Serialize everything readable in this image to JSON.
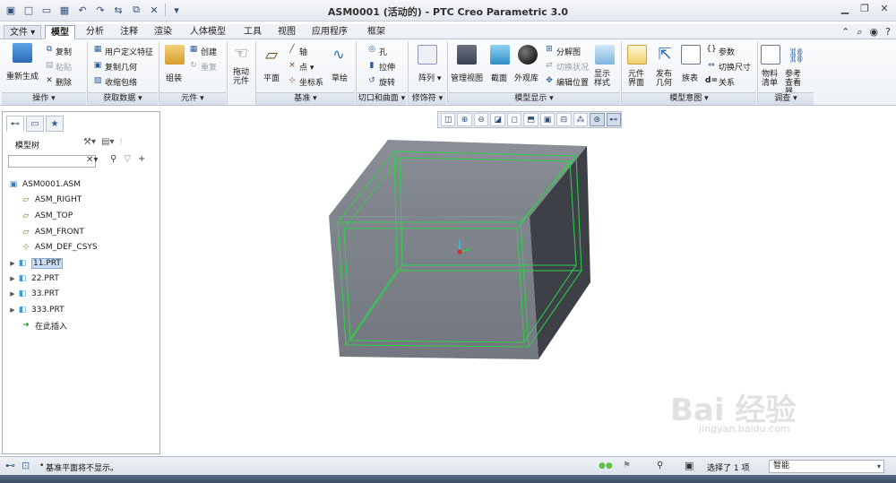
{
  "window": {
    "title": "ASM0001 (活动的) - PTC Creo Parametric 3.0"
  },
  "tabs": [
    "文件",
    "模型",
    "分析",
    "注释",
    "渲染",
    "人体模型",
    "工具",
    "视图",
    "应用程序",
    "框架"
  ],
  "active_tab": "模型",
  "ribbon": {
    "operations": {
      "regenerate": "重新生成",
      "copy": "复制",
      "paste": "粘贴",
      "delete": "删除",
      "group": "操作"
    },
    "get_data": {
      "udf": "用户定义特征",
      "copy_geom": "复制几何",
      "shrinkwrap": "收缩包络",
      "group": "获取数据"
    },
    "component": {
      "assemble": "组装",
      "create": "创建",
      "repeat": "重复",
      "group": "元件"
    },
    "drag": "拖动元件",
    "datum": {
      "plane": "平面",
      "axis": "轴",
      "point": "点",
      "csys": "坐标系",
      "sketch": "草绘",
      "group": "基准"
    },
    "cut_surface": {
      "hole": "孔",
      "extrude": "拉伸",
      "revolve": "旋转",
      "group": "切口和曲面"
    },
    "modifiers": {
      "pattern": "阵列",
      "group": "修饰符"
    },
    "model_display": {
      "manage_views": "管理视图",
      "section": "截面",
      "appearance": "外观库",
      "explode": "分解图",
      "toggle_state": "切换状况",
      "edit_position": "编辑位置",
      "display_style": "显示样式",
      "group": "模型显示"
    },
    "model_intent": {
      "component_interface": "元件界面",
      "publish_geom": "发布几何",
      "family_table": "族表",
      "parameters": "参数",
      "switch_dims": "切换尺寸",
      "relations": "关系",
      "group": "模型意图"
    },
    "investigate": {
      "bom": "物料清单",
      "ref_viewer": "参考查看器",
      "group": "调查"
    }
  },
  "model_tree": {
    "header": "模型树",
    "search_placeholder": "",
    "items": [
      {
        "label": "ASM0001.ASM",
        "type": "assembly",
        "expandable": false,
        "selected": false
      },
      {
        "label": "ASM_RIGHT",
        "type": "plane",
        "expandable": false,
        "selected": false
      },
      {
        "label": "ASM_TOP",
        "type": "plane",
        "expandable": false,
        "selected": false
      },
      {
        "label": "ASM_FRONT",
        "type": "plane",
        "expandable": false,
        "selected": false
      },
      {
        "label": "ASM_DEF_CSYS",
        "type": "csys",
        "expandable": false,
        "selected": false
      },
      {
        "label": "11.PRT",
        "type": "part",
        "expandable": true,
        "selected": true
      },
      {
        "label": "22.PRT",
        "type": "part",
        "expandable": true,
        "selected": false
      },
      {
        "label": "33.PRT",
        "type": "part",
        "expandable": true,
        "selected": false
      },
      {
        "label": "333.PRT",
        "type": "part",
        "expandable": true,
        "selected": false
      },
      {
        "label": "在此插入",
        "type": "insert",
        "expandable": false,
        "selected": false
      }
    ]
  },
  "status": {
    "message": "基准平面将不显示。",
    "selection": "选择了 1 项",
    "filter": "智能"
  },
  "watermark": {
    "text": "Bai 经验",
    "url": "jingyan.baidu.com"
  },
  "colors": {
    "accent": "#3a78c2",
    "model_face": "#7b7f88",
    "model_edge_highlight": "#2fd24a",
    "selection": "#c9ddf5"
  }
}
